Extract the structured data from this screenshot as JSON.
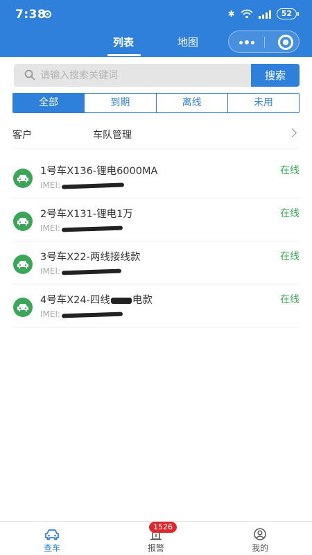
{
  "status_bar": {
    "time": "7:38",
    "battery": "52"
  },
  "nav": {
    "tabs": [
      {
        "label": "列表"
      },
      {
        "label": "地图"
      }
    ]
  },
  "search": {
    "placeholder": "请输入搜索关键词",
    "button_label": "搜索"
  },
  "filters": [
    {
      "label": "全部"
    },
    {
      "label": "到期"
    },
    {
      "label": "离线"
    },
    {
      "label": "未用"
    }
  ],
  "fleet": {
    "customer_label": "客户",
    "value": "车队管理"
  },
  "vehicles": [
    {
      "name": "1号车X136-锂电6000MA",
      "imei_label": "IMEI:",
      "status": "在线"
    },
    {
      "name": "2号车X131-锂电1万",
      "imei_label": "IMEI:",
      "status": "在线"
    },
    {
      "name": "3号车X22-两线接线款",
      "imei_label": "IMEI:",
      "status": "在线"
    },
    {
      "name_prefix": "4号车X24-四线",
      "name_suffix": "电款",
      "imei_label": "IMEI:",
      "status": "在线"
    }
  ],
  "bottom_nav": {
    "items": [
      {
        "label": "查车",
        "icon": "car-icon"
      },
      {
        "label": "报警",
        "icon": "alarm-icon",
        "badge": "1526"
      },
      {
        "label": "我的",
        "icon": "profile-icon"
      }
    ]
  },
  "colors": {
    "primary": "#2f80db",
    "online": "#3aa657",
    "badge": "#e0282f"
  }
}
